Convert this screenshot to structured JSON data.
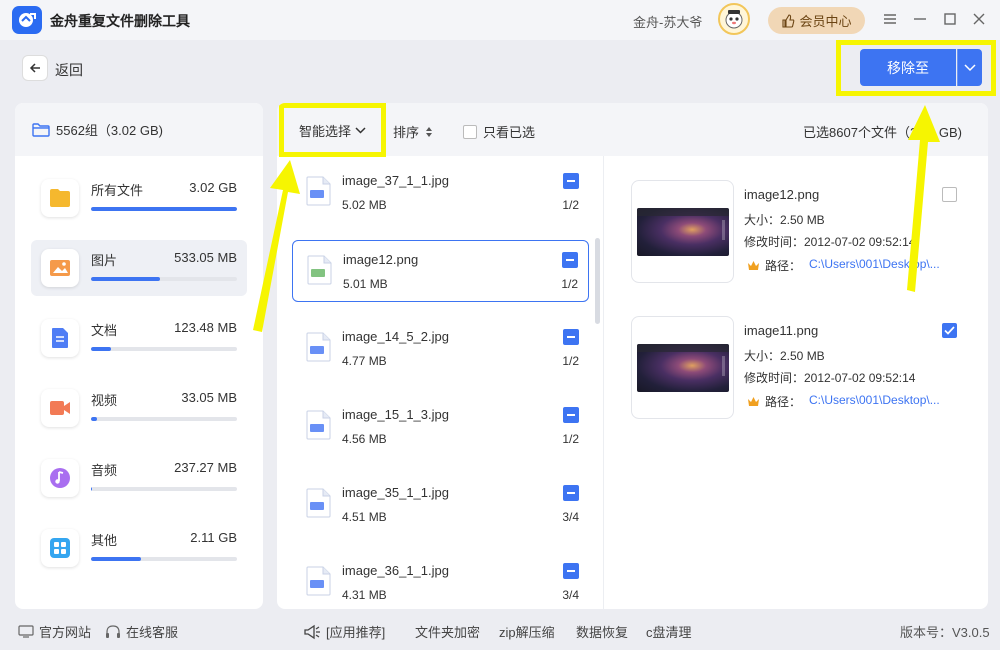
{
  "app": {
    "title": "金舟重复文件删除工具",
    "user": "金舟-苏大爷",
    "vip_label": "会员中心"
  },
  "nav": {
    "back_label": "返回",
    "move_label": "移除至"
  },
  "sidebar": {
    "summary": "5562组（3.02 GB)",
    "categories": [
      {
        "name": "所有文件",
        "size": "3.02 GB",
        "fill": 1.0,
        "color": "#f5b82e"
      },
      {
        "name": "图片",
        "size": "533.05 MB",
        "fill": 0.47,
        "color": "#f59a4a"
      },
      {
        "name": "文档",
        "size": "123.48 MB",
        "fill": 0.14,
        "color": "#4f7df5"
      },
      {
        "name": "视频",
        "size": "33.05 MB",
        "fill": 0.04,
        "color": "#f27a55"
      },
      {
        "name": "音频",
        "size": "237.27 MB",
        "fill": 0.01,
        "color": "#a96ef0"
      },
      {
        "name": "其他",
        "size": "2.11 GB",
        "fill": 0.34,
        "color": "#35a6f0"
      }
    ]
  },
  "toolbar": {
    "smart_select": "智能选择",
    "sort": "排序",
    "only_selected": "只看已选",
    "selected_count": "已选8607个文件（2.71 GB)"
  },
  "files": [
    {
      "name": "image_37_1_1.jpg",
      "size": "5.02 MB",
      "group": "1/2",
      "type": "JPG"
    },
    {
      "name": "image12.png",
      "size": "5.01 MB",
      "group": "1/2",
      "type": "PNG"
    },
    {
      "name": "image_14_5_2.jpg",
      "size": "4.77 MB",
      "group": "1/2",
      "type": "JPG"
    },
    {
      "name": "image_15_1_3.jpg",
      "size": "4.56 MB",
      "group": "1/2",
      "type": "JPG"
    },
    {
      "name": "image_35_1_1.jpg",
      "size": "4.51 MB",
      "group": "3/4",
      "type": "JPG"
    },
    {
      "name": "image_36_1_1.jpg",
      "size": "4.31 MB",
      "group": "3/4",
      "type": "JPG"
    }
  ],
  "details": [
    {
      "name": "image12.png",
      "size": "大小：2.50 MB",
      "time": "修改时间：2012-07-02 09:52:14",
      "path_label": "路径：",
      "path": "C:\\Users\\001\\Desktop\\...",
      "checked": false
    },
    {
      "name": "image11.png",
      "size": "大小：2.50 MB",
      "time": "修改时间：2012-07-02 09:52:14",
      "path_label": "路径：",
      "path": "C:\\Users\\001\\Desktop\\...",
      "checked": true
    }
  ],
  "footer": {
    "site": "官方网站",
    "service": "在线客服",
    "recommend": "[应用推荐]",
    "links": [
      "文件夹加密",
      "zip解压缩",
      "数据恢复",
      "c盘清理"
    ],
    "version": "版本号：V3.0.5"
  },
  "colors": {
    "accent": "#3d74f2",
    "highlight": "#f6f501",
    "vip": "#f1d7b6"
  }
}
